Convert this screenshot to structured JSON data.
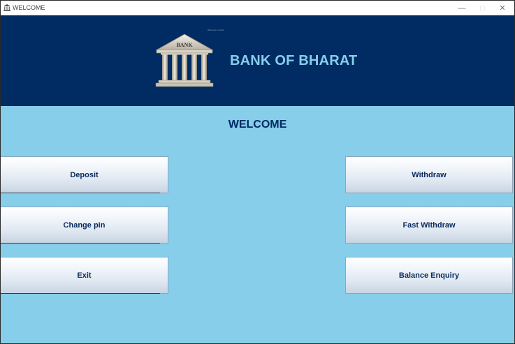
{
  "window": {
    "title": "WELCOME",
    "minimize_glyph": "—",
    "maximize_glyph": "□",
    "close_glyph": "✕"
  },
  "header": {
    "logo_text": "BANK",
    "tiny_text": "Welcome to bank",
    "title": "BANK OF BHARAT"
  },
  "main": {
    "heading": "WELCOME",
    "buttons": {
      "deposit": "Deposit",
      "withdraw": "Withdraw",
      "change_pin": "Change pin",
      "fast_withdraw": "Fast Withdraw",
      "exit": "Exit",
      "balance_enquiry": "Balance Enquiry"
    }
  },
  "colors": {
    "header_bg": "#002b63",
    "body_bg": "#87ceeb",
    "title_color": "#87ceeb",
    "button_text": "#0b2b5e"
  },
  "icons": {
    "app": "bank-icon",
    "logo": "bank-building-icon"
  }
}
